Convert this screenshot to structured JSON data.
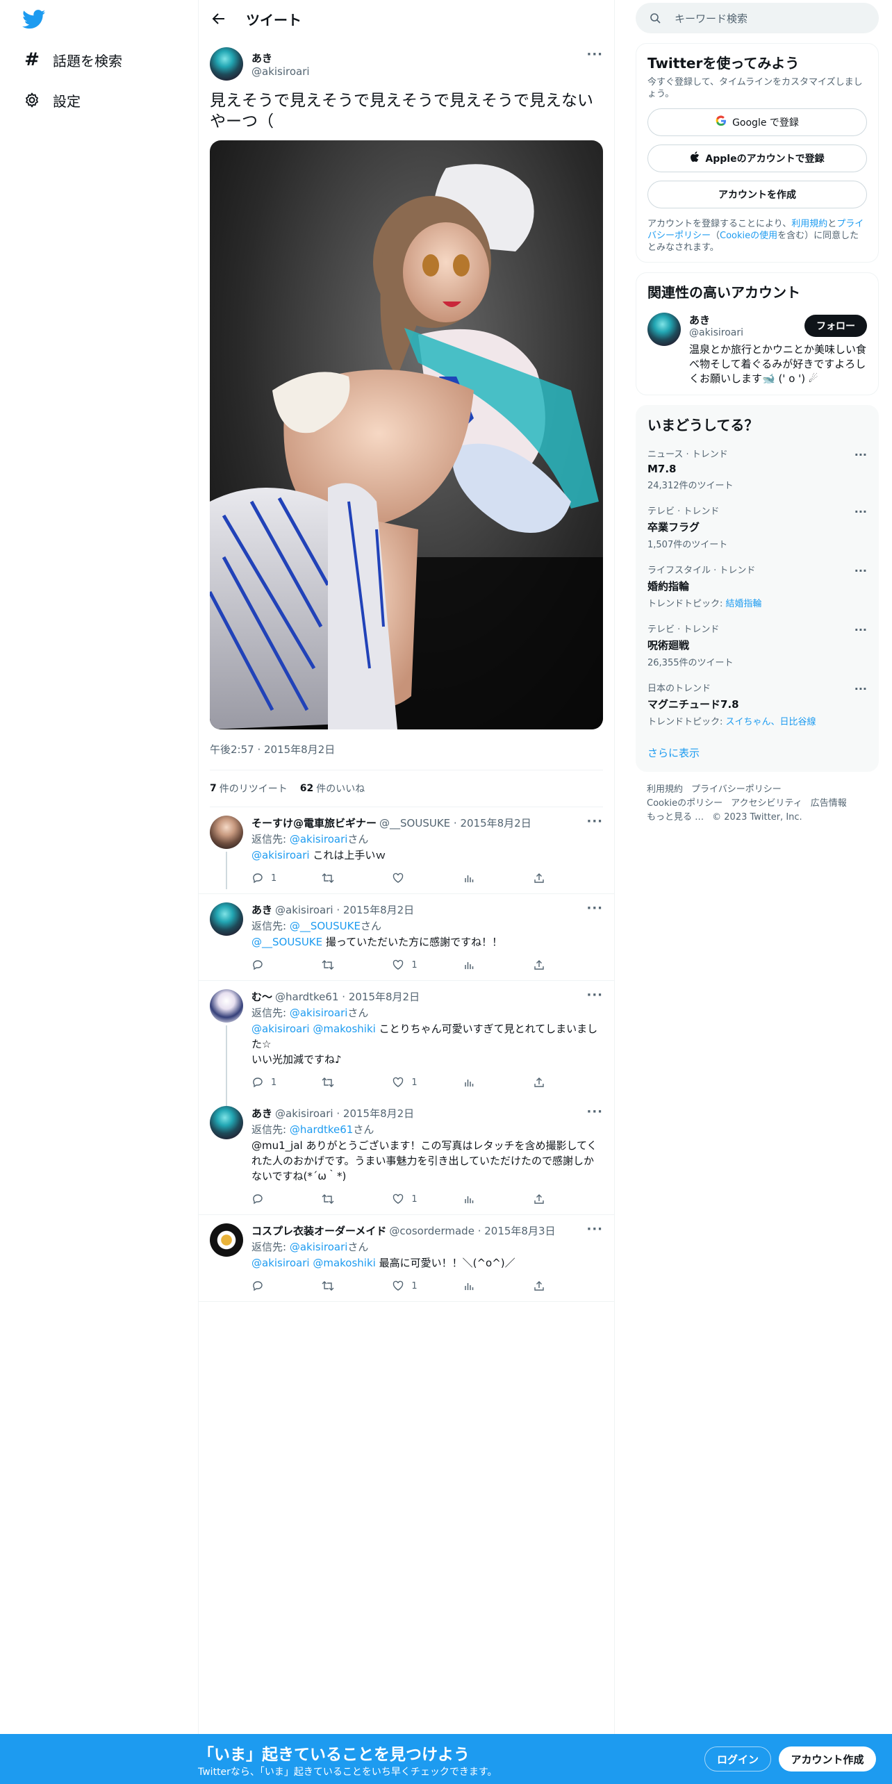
{
  "nav": {
    "explore_label": "話題を検索",
    "settings_label": "設定"
  },
  "header": {
    "title": "ツイート"
  },
  "tweet": {
    "author_name": "あき",
    "author_handle": "@akisiroari",
    "text": "見えそうで見えそうで見えそうで見えそうで見えないやーつ（",
    "time": "午後2:57 · 2015年8月2日",
    "retweets": "7",
    "retweets_label": "件のリツイート",
    "likes": "62",
    "likes_label": "件のいいね"
  },
  "replies": [
    {
      "name": "そーすけ@電車旅ビギナー",
      "handle": "@__SOUSUKE",
      "date": "· 2015年8月2日",
      "replying_prefix": "返信先:",
      "replying_to": "@akisiroari",
      "replying_suffix": "さん",
      "mentions": "@akisiroari",
      "text": " これは上手いｗ",
      "reply_count": "1",
      "retweet_count": "",
      "like_count": ""
    },
    {
      "name": "あき",
      "handle": "@akisiroari",
      "date": "· 2015年8月2日",
      "replying_prefix": "返信先:",
      "replying_to": "@__SOUSUKE",
      "replying_suffix": "さん",
      "mentions": "@__SOUSUKE",
      "text": " 撮っていただいた方に感謝ですね！！",
      "reply_count": "",
      "retweet_count": "",
      "like_count": "1"
    },
    {
      "name": "む～",
      "handle": "@hardtke61",
      "date": "· 2015年8月2日",
      "replying_prefix": "返信先:",
      "replying_to": "@akisiroari",
      "replying_suffix": "さん",
      "mentions": "@akisiroari @makoshiki",
      "text": " ことりちゃん可愛いすぎて見とれてしまいました☆",
      "text2": "いい光加減ですね♪",
      "reply_count": "1",
      "retweet_count": "",
      "like_count": "1"
    },
    {
      "name": "あき",
      "handle": "@akisiroari",
      "date": "· 2015年8月2日",
      "replying_prefix": "返信先:",
      "replying_to": "@hardtke61",
      "replying_suffix": "さん",
      "mentions": "",
      "text": "@mu1_jal ありがとうございます！この写真はレタッチを含め撮影してくれた人のおかげです。うまい事魅力を引き出していただけたので感謝しかないですね(*´ω｀*)",
      "reply_count": "",
      "retweet_count": "",
      "like_count": "1"
    },
    {
      "name": "コスプレ衣装オーダーメイド",
      "handle": "@cosordermade",
      "date": "· 2015年8月3日",
      "replying_prefix": "返信先:",
      "replying_to": "@akisiroari",
      "replying_suffix": "さん",
      "mentions": "@akisiroari @makoshiki",
      "text": " 最高に可愛い！！＼(^o^)／",
      "reply_count": "",
      "retweet_count": "",
      "like_count": "1"
    }
  ],
  "search": {
    "placeholder": "キーワード検索"
  },
  "signup": {
    "title": "Twitterを使ってみよう",
    "desc": "今すぐ登録して、タイムラインをカスタマイズしましょう。",
    "google": "Google で登録",
    "apple": "Appleのアカウントで登録",
    "create": "アカウントを作成",
    "legal_1": "アカウントを登録することにより、",
    "legal_terms": "利用規約",
    "legal_2": "と",
    "legal_privacy": "プライバシーポリシー",
    "legal_3": "（",
    "legal_cookie": "Cookieの使用",
    "legal_4": "を含む）に同意したとみなされます。"
  },
  "relevant": {
    "title": "関連性の高いアカウント",
    "name": "あき",
    "handle": "@akisiroari",
    "follow": "フォロー",
    "bio": "温泉とか旅行とかウニとか美味しい食べ物そして着ぐるみが好きですよろしくお願いします🐋 (' o ') ☄"
  },
  "trends": {
    "title": "いまどうしてる？",
    "items": [
      {
        "category": "ニュース · トレンド",
        "title": "M7.8",
        "count": "24,312件のツイート",
        "topic_label": "",
        "topic": ""
      },
      {
        "category": "テレビ · トレンド",
        "title": "卒業フラグ",
        "count": "1,507件のツイート",
        "topic_label": "",
        "topic": ""
      },
      {
        "category": "ライフスタイル · トレンド",
        "title": "婚約指輪",
        "count": "",
        "topic_label": "トレンドトピック: ",
        "topic": "結婚指輪"
      },
      {
        "category": "テレビ · トレンド",
        "title": "呪術廻戦",
        "count": "26,355件のツイート",
        "topic_label": "",
        "topic": ""
      },
      {
        "category": "日本のトレンド",
        "title": "マグニチュード7.8",
        "count": "",
        "topic_label": "トレンドトピック: ",
        "topic": "スイちゃん、日比谷線"
      }
    ],
    "more": "さらに表示"
  },
  "footer": {
    "links": [
      "利用規約",
      "プライバシーポリシー",
      "Cookieのポリシー",
      "アクセシビリティ",
      "広告情報",
      "もっと見る …"
    ],
    "copyright": "© 2023 Twitter, Inc."
  },
  "banner": {
    "title": "「いま」起きていることを見つけよう",
    "subtitle": "Twitterなら、「いま」起きていることをいち早くチェックできます。",
    "login": "ログイン",
    "signup": "アカウント作成"
  },
  "colors": {
    "accent": "#1d9bf0",
    "text": "#0f1419",
    "muted": "#536471"
  }
}
